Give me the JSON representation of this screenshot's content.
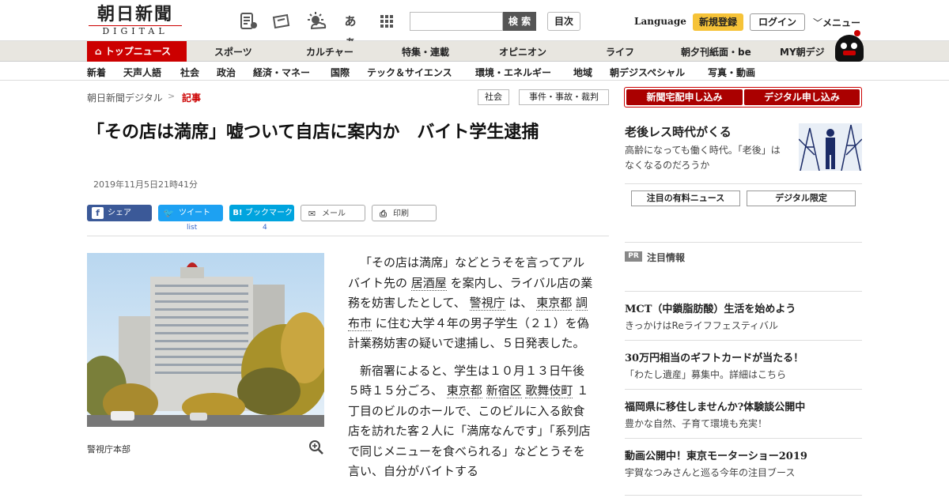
{
  "header": {
    "logo_main": "朝日新聞",
    "logo_sub": "DIGITAL",
    "search_button": "検 索",
    "toc_button": "目次",
    "language": "Language",
    "signup": "新規登録",
    "login": "ログイン",
    "menu": "メニュー",
    "font_size_icon_label": "あぁ"
  },
  "nav_primary": {
    "top_news": "トップニュース",
    "items": [
      "スポーツ",
      "カルチャー",
      "特集・連載",
      "オピニオン",
      "ライフ",
      "朝夕刊紙面・be",
      "MY朝デジ"
    ]
  },
  "nav_secondary": {
    "items": [
      "新着",
      "天声人語",
      "社会",
      "政治",
      "経済・マネー",
      "国際",
      "テック＆サイエンス",
      "環境・エネルギー",
      "地域",
      "朝デジスペシャル",
      "写真・動画"
    ]
  },
  "breadcrumb": {
    "home": "朝日新聞デジタル",
    "separator": ">",
    "current": "記事"
  },
  "category_tags": [
    "社会",
    "事件・事故・裁判"
  ],
  "article": {
    "title": "「その店は満席」嘘ついて自店に案内か　バイト学生逮捕",
    "date": "2019年11月5日21時41分",
    "share": {
      "facebook": "シェア",
      "twitter": "ツイート",
      "twitter_count": "list",
      "hatena": "ブックマーク",
      "hatena_count": "4",
      "mail": "メール",
      "print": "印刷"
    },
    "photo_caption": "警視庁本部",
    "p1_a": "「その店は満席」などとうそを言ってアルバイト先の",
    "p1_l1": "居酒屋",
    "p1_b": "を案内し、ライバル店の業務を妨害したとして、",
    "p1_l2": "警視庁",
    "p1_c": "は、",
    "p1_l3": "東京都",
    "p1_l4": "調布市",
    "p1_d": "に住む大学４年の男子学生（２１）を偽計業務妨害の疑いで逮捕し、５日発表した。",
    "p2_a": "新宿署によると、学生は１０月１３日午後５時１５分ごろ、",
    "p2_l1": "東京都",
    "p2_l2": "新宿区",
    "p2_l3": "歌舞伎町",
    "p2_b": "１丁目のビルのホールで、このビルに入る飲食店を訪れた客２人に「満席なんです」「系列店で同じメニューを食べられる」などとうそを言い、自分がバイトする"
  },
  "sidebar": {
    "order_paper": "新聞宅配申し込み",
    "order_digital": "デジタル申し込み",
    "feature_title": "老後レス時代がくる",
    "feature_desc": "高齢になっても働く時代。「老後」はなくなるのだろうか",
    "tab_paid": "注目の有料ニュース",
    "tab_digital": "デジタル限定",
    "pr_label": "PR",
    "pr_heading": "注目情報",
    "pr_items": [
      {
        "title": "MCT（中鎖脂肪酸）生活を始めよう",
        "desc": "きっかけはReライフフェスティバル"
      },
      {
        "title": "30万円相当のギフトカードが当たる！",
        "desc": "「わたし遺産」募集中。詳細はこちら"
      },
      {
        "title": "福岡県に移住しませんか?体験談公開中",
        "desc": "豊かな自然、子育て環境も充実！"
      },
      {
        "title": "動画公開中！東京モーターショー2019",
        "desc": "宇賀なつみさんと巡る今年の注目ブース"
      }
    ]
  },
  "colors": {
    "brand_red": "#cc0000",
    "signup_yellow": "#f6c338",
    "facebook": "#3b5998",
    "twitter": "#1da1f2",
    "hatena": "#00a4de"
  }
}
